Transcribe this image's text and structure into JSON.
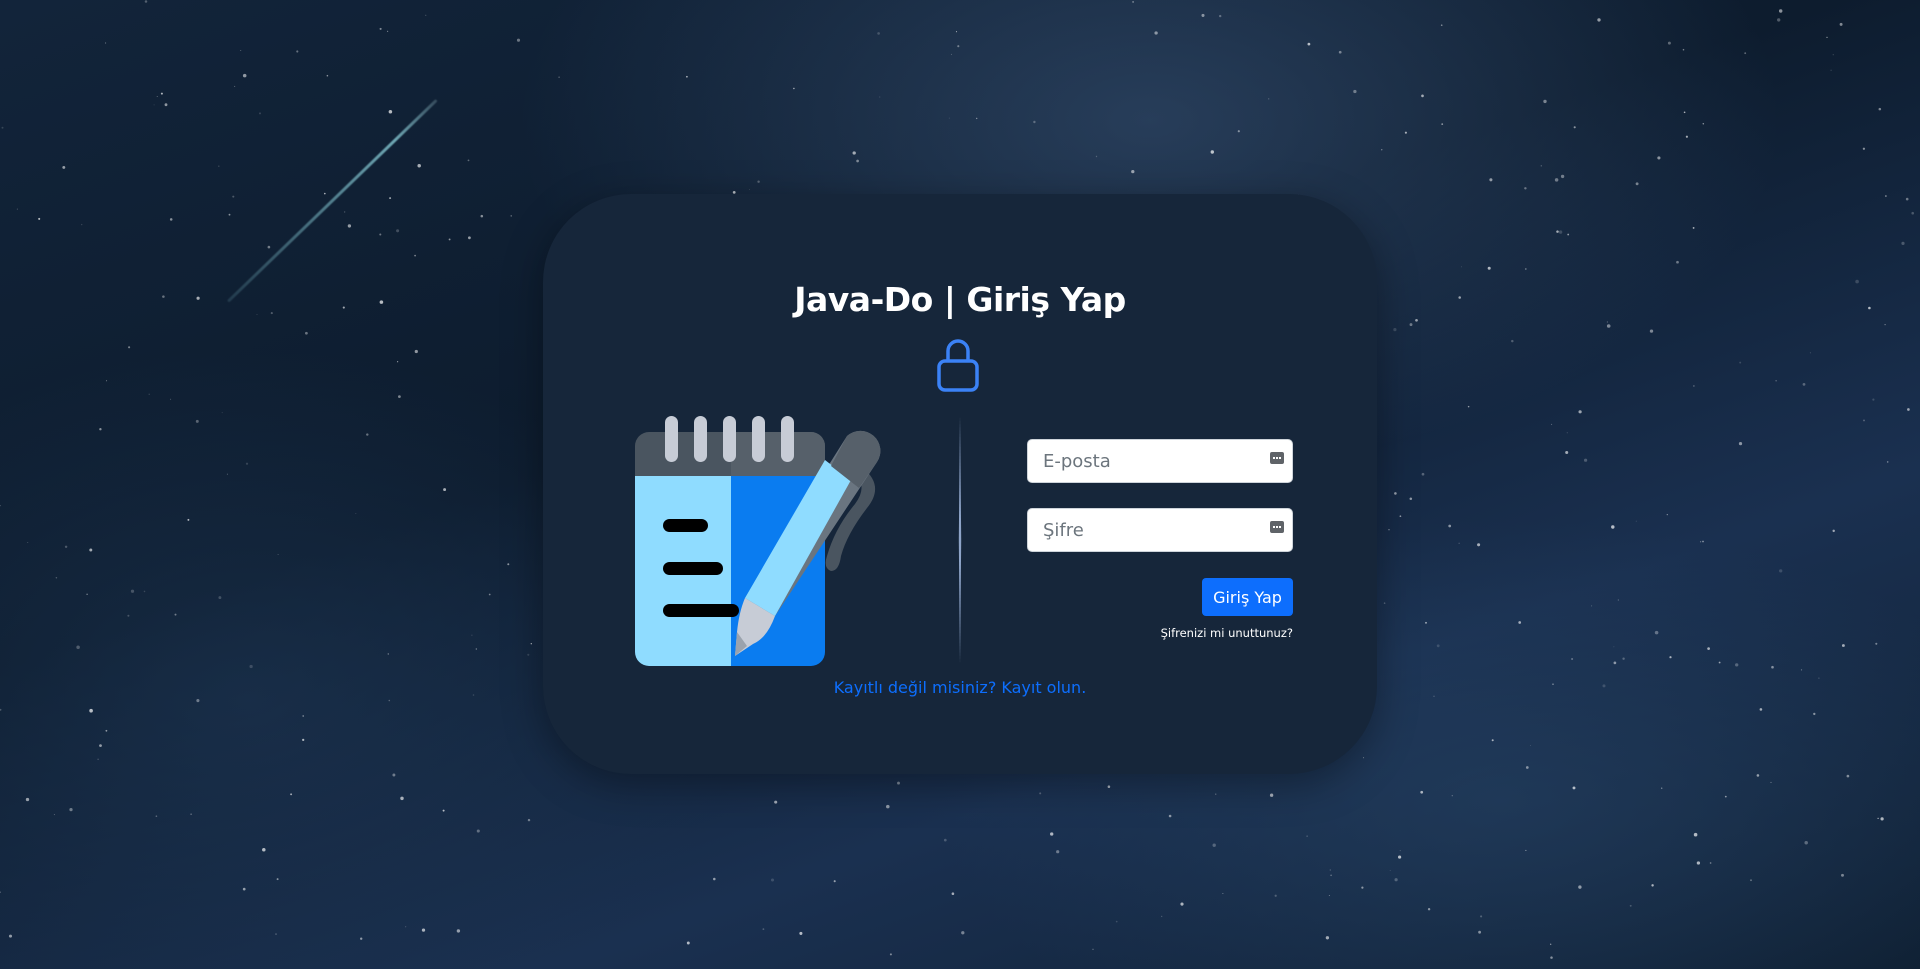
{
  "page": {
    "title": "Java-Do | Giriş Yap"
  },
  "icons": {
    "lock": "lock-icon",
    "illustration": "notepad-pen-icon",
    "password_key": "key-icon"
  },
  "form": {
    "email_placeholder": "E-posta",
    "password_placeholder": "Şifre",
    "submit_label": "Giriş Yap",
    "forgot_label": "Şifrenizi mi unuttunuz?"
  },
  "register": {
    "label": "Kayıtlı değil misiniz? Kayıt olun."
  },
  "colors": {
    "card_bg": "#16263a",
    "accent": "#0d6efd",
    "lock": "#3b82f6"
  }
}
